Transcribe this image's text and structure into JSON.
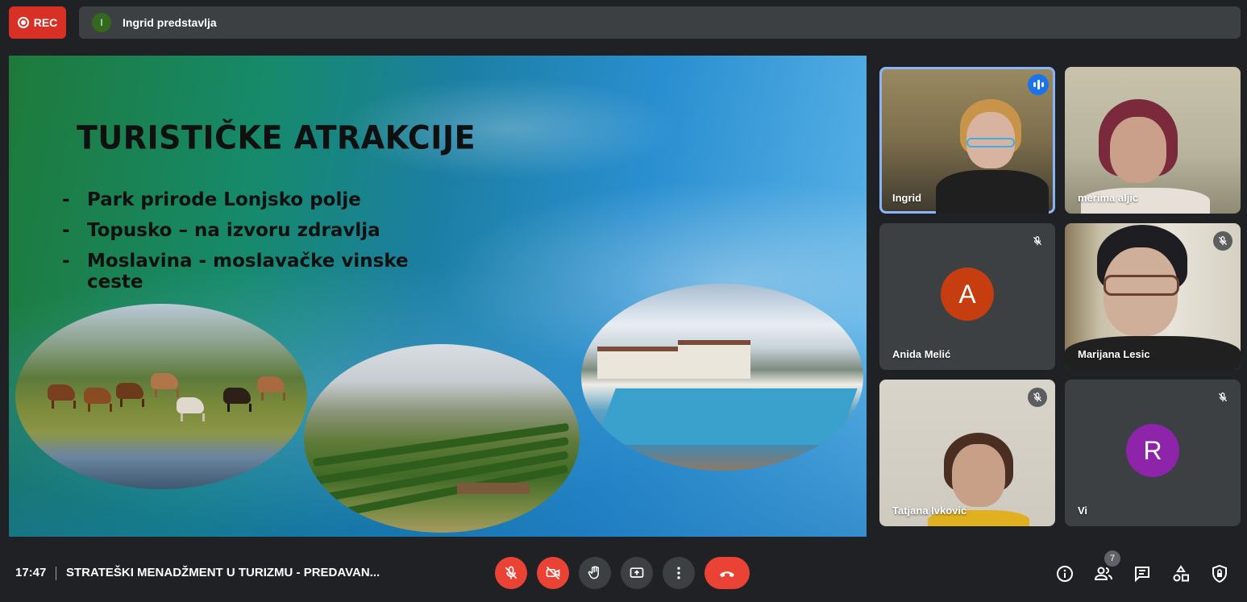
{
  "top_bar": {
    "rec_label": "REC",
    "presenter_initial": "I",
    "presenting_text": "Ingrid predstavlja"
  },
  "slide": {
    "title": "TURISTIČKE ATRAKCIJE",
    "bullets": [
      "Park prirode Lonjsko polje",
      "Topusko – na izvoru zdravlja",
      "Moslavina - moslavačke vinske ceste"
    ]
  },
  "participants": [
    {
      "name": "Ingrid",
      "speaking": true,
      "video": true
    },
    {
      "name": "merima aljic",
      "video": true
    },
    {
      "name": "Anida Melić",
      "initial": "A",
      "muted": true,
      "avatar_color": "#c63d0f"
    },
    {
      "name": "Marijana Lesic",
      "muted": true,
      "video": true
    },
    {
      "name": "Tatjana Ivković",
      "muted": true,
      "video": true
    },
    {
      "name": "Vi",
      "initial": "R",
      "muted": true,
      "avatar_color": "#8e24aa"
    }
  ],
  "bottom_bar": {
    "time": "17:47",
    "meeting_title": "STRATEŠKI MENADŽMENT U TURIZMU - PREDAVAN...",
    "participant_count": "7",
    "controls": [
      "mic-off",
      "camera-off",
      "raise-hand",
      "present-screen",
      "more-options",
      "leave-call"
    ],
    "right_icons": [
      "info",
      "people",
      "chat",
      "activities",
      "host-controls"
    ]
  },
  "colors": {
    "background": "#202124",
    "panel": "#3c4043",
    "danger": "#ea4335",
    "accent": "#1a73e8",
    "active_outline": "#8ab4f8"
  }
}
